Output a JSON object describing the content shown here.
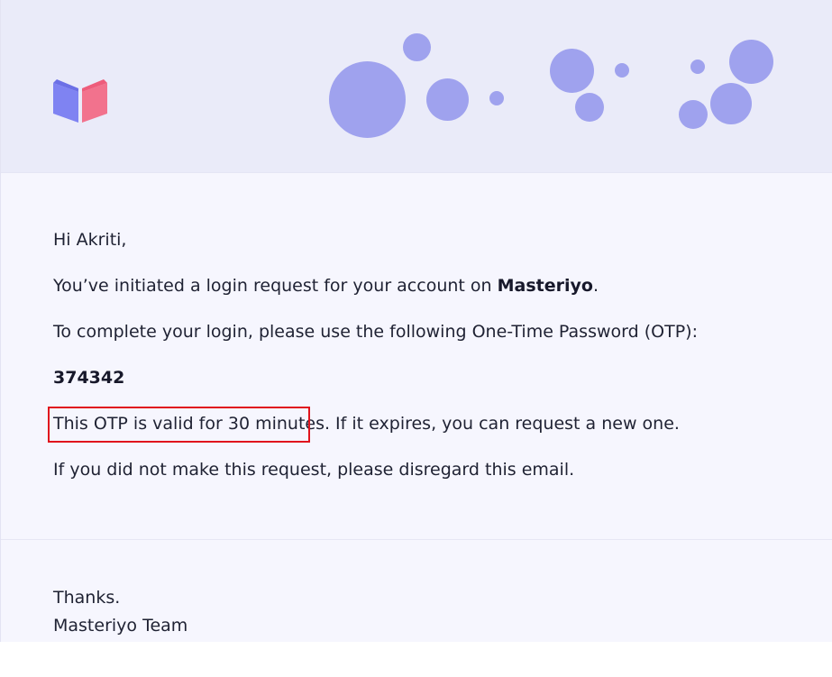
{
  "brand": {
    "logo_icon": "open-book-icon",
    "colors": {
      "book_left": "#7f83f2",
      "book_right": "#f2728d",
      "bubbles": "#9fa2ee",
      "header_bg": "#eaebf9",
      "body_bg": "#f6f6fe",
      "highlight": "#e0141d"
    }
  },
  "email": {
    "greeting": "Hi Akriti,",
    "intro_prefix": "You’ve initiated a login request for your account on ",
    "intro_brand": "Masteriyo",
    "intro_suffix": ".",
    "instruction": "To complete your login, please use the following One-Time Password (OTP):",
    "otp_code": "374342",
    "validity_highlighted": "This OTP is valid for 30 minutes.",
    "validity_rest": " If it expires, you can request a new one.",
    "disregard": "If you did not make this request, please disregard this email.",
    "thanks": "Thanks.",
    "signature": "Masteriyo Team"
  }
}
